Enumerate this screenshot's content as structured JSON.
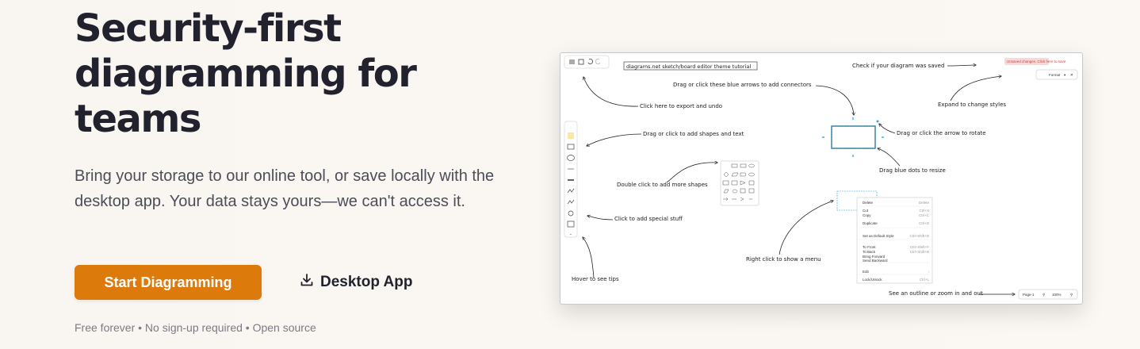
{
  "hero": {
    "title": "Security-first diagramming for teams",
    "subtitle": "Bring your storage to our online tool, or save locally with the desktop app. Your data stays yours—we can't access it.",
    "primary_button": "Start Diagramming",
    "secondary_button": "Desktop App",
    "footnote": "Free forever • No sign-up required • Open source"
  },
  "screenshot": {
    "title_label": "diagrams.net sketch/board editor theme tutorial",
    "saved_badge": "Unsaved changes. Click here to save.",
    "format_button": "Format",
    "page_selector": "Page-1",
    "zoom_level": "100%",
    "annotations": {
      "export_undo": "Click here to export and undo",
      "connectors": "Drag or click these blue arrows to add connectors",
      "check_saved": "Check if your diagram was saved",
      "expand_styles": "Expand to change styles",
      "shapes_text": "Drag or click to add shapes and text",
      "rotate": "Drag or click the arrow to rotate",
      "resize": "Drag blue dots to resize",
      "more_shapes": "Double click to add more shapes",
      "special_stuff": "Click to add special stuff",
      "right_click": "Right click to show a menu",
      "hover_tips": "Hover to see tips",
      "outline_zoom": "See an outline or zoom in and out"
    },
    "context_menu": [
      {
        "label": "Delete",
        "shortcut": "Delete"
      },
      {
        "label": "Cut",
        "shortcut": "Ctrl+X"
      },
      {
        "label": "Copy",
        "shortcut": "Ctrl+C"
      },
      {
        "label": "Duplicate",
        "shortcut": "Ctrl+D"
      },
      {
        "label": "Set as Default Style",
        "shortcut": "Ctrl+Shift+D"
      },
      {
        "label": "To Front",
        "shortcut": "Ctrl+Shift+F"
      },
      {
        "label": "To Back",
        "shortcut": "Ctrl+Shift+B"
      },
      {
        "label": "Bring Forward",
        "shortcut": ""
      },
      {
        "label": "Send Backward",
        "shortcut": ""
      },
      {
        "label": "Edit",
        "shortcut": "›"
      },
      {
        "label": "Lock/Unlock",
        "shortcut": "Ctrl+L"
      }
    ]
  }
}
